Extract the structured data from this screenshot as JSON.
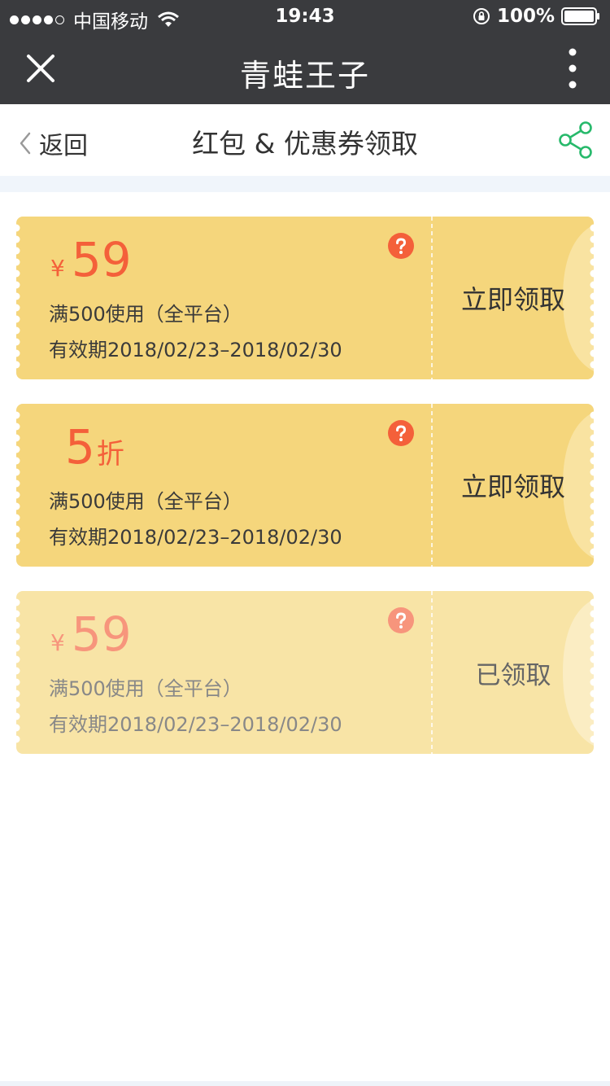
{
  "status_bar": {
    "carrier": "中国移动",
    "time": "19:43",
    "battery": "100%"
  },
  "title_bar": {
    "title": "青蛙王子"
  },
  "nav_bar": {
    "back_label": "返回",
    "title": "红包 & 优惠券领取"
  },
  "colors": {
    "active_coupon_bg": "#f5d67c",
    "used_coupon_bg": "#f8e4a6",
    "accent_red": "#f4603a",
    "share_green": "#27b96b",
    "header_dark": "#3a3b3e"
  },
  "coupons": [
    {
      "currency": "¥",
      "amount": "59",
      "unit": "",
      "condition": "满500使用（全平台）",
      "validity": "有效期2018/02/23–2018/02/30",
      "action": "立即领取",
      "claimed": false
    },
    {
      "currency": "",
      "amount": "5",
      "unit": "折",
      "condition": "满500使用（全平台）",
      "validity": "有效期2018/02/23–2018/02/30",
      "action": "立即领取",
      "claimed": false
    },
    {
      "currency": "¥",
      "amount": "59",
      "unit": "",
      "condition": "满500使用（全平台）",
      "validity": "有效期2018/02/23–2018/02/30",
      "action": "已领取",
      "claimed": true
    }
  ]
}
